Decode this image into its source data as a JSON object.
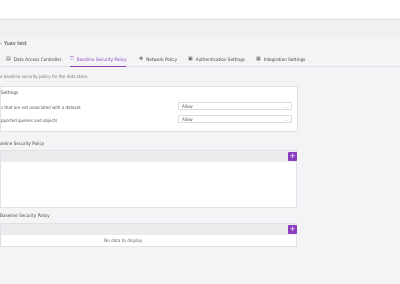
{
  "header": {
    "title": "Yuav test",
    "chevron": "chevron-left-icon"
  },
  "tabs": [
    {
      "label": "Data Access Controller",
      "icon": "server-icon",
      "active": false
    },
    {
      "label": "Baseline Security Policy",
      "icon": "shield-icon",
      "active": true
    },
    {
      "label": "Network Policy",
      "icon": "network-icon",
      "active": false
    },
    {
      "label": "Authentication Settings",
      "icon": "lock-icon",
      "active": false
    },
    {
      "label": "Integration Settings",
      "icon": "grid-icon",
      "active": false
    }
  ],
  "description": "e baseline security policy for the data store.",
  "settings_card": {
    "header": "Settings",
    "rows": [
      {
        "label": "s that are not associated with a dataset",
        "value": "Allow"
      },
      {
        "label": "pported queries and objects",
        "value": "Allow"
      }
    ]
  },
  "policy_section": {
    "title": "seline Security Policy"
  },
  "secondary_section": {
    "title": "Baseline Security Policy",
    "empty_message": "No data to display"
  },
  "colors": {
    "accent": "#8a3ec0",
    "background": "#f4f4f6",
    "header_row": "#ececef"
  }
}
